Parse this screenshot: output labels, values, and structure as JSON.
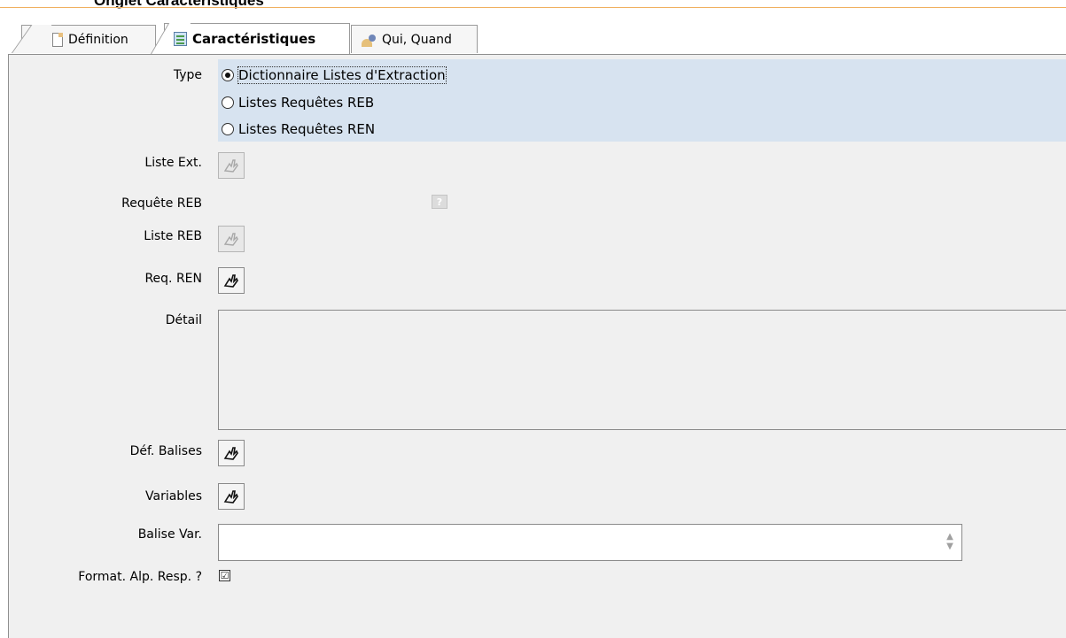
{
  "page": {
    "heading": "Onglet Caractéristiques"
  },
  "tabs": [
    {
      "label": "Définition",
      "icon": "document-icon",
      "active": false
    },
    {
      "label": "Caractéristiques",
      "icon": "sheet-icon",
      "active": true
    },
    {
      "label": "Qui, Quand",
      "icon": "person-icon",
      "active": false
    }
  ],
  "form": {
    "type_label": "Type",
    "type_options": [
      {
        "label": "Dictionnaire Listes d'Extraction",
        "selected": true
      },
      {
        "label": "Listes Requêtes REB",
        "selected": false
      },
      {
        "label": "Listes Requêtes REN",
        "selected": false
      }
    ],
    "liste_ext_label": "Liste Ext.",
    "requete_reb_label": "Requête REB",
    "help_symbol": "?",
    "liste_reb_label": "Liste REB",
    "req_ren_label": "Req. REN",
    "detail_label": "Détail",
    "detail_value": "",
    "def_balises_label": "Déf. Balises",
    "variables_label": "Variables",
    "balise_var_label": "Balise Var.",
    "balise_var_value": "",
    "format_label": "Format. Alp. Resp. ?",
    "format_checked": true,
    "check_mark": "☑"
  },
  "colors": {
    "accent_rule": "#f0b060",
    "type_highlight": "#d7e3f0",
    "panel_bg": "#f0f0f0"
  }
}
